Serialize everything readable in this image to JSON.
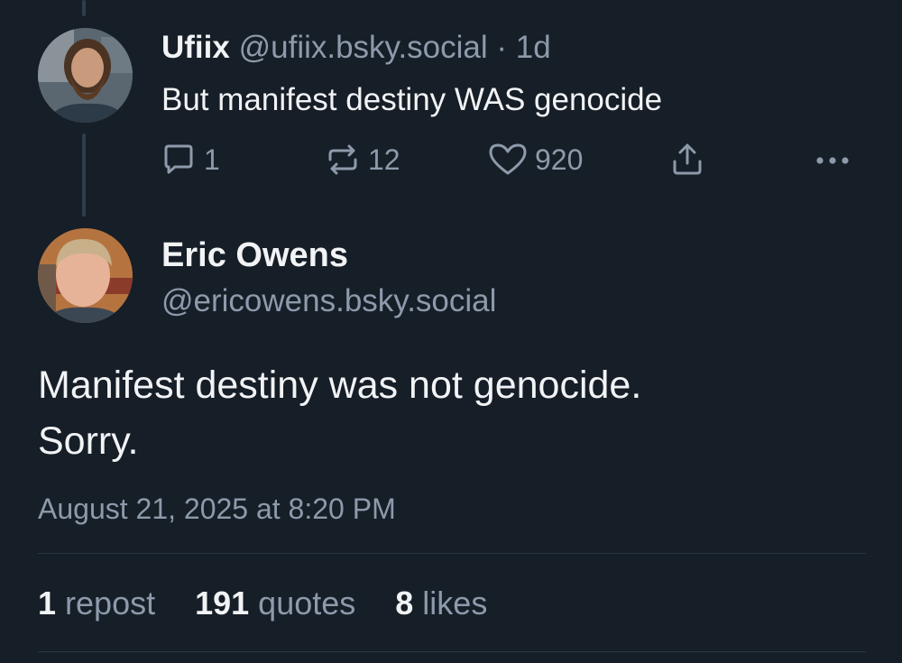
{
  "parent_post": {
    "display_name": "Ufiix",
    "handle": "@ufiix.bsky.social",
    "separator": "·",
    "age": "1d",
    "text": "But manifest destiny WAS genocide",
    "actions": {
      "reply_count": "1",
      "repost_count": "12",
      "like_count": "920"
    },
    "avatar": "avatar-bearded-man"
  },
  "main_post": {
    "display_name": "Eric Owens",
    "handle": "@ericowens.bsky.social",
    "text_lines": [
      "Manifest destiny was not genocide.",
      "Sorry."
    ],
    "timestamp": "August 21, 2025 at 8:20 PM",
    "avatar": "avatar-blond-man",
    "stats": {
      "reposts_num": "1",
      "reposts_label": "repost",
      "quotes_num": "191",
      "quotes_label": "quotes",
      "likes_num": "8",
      "likes_label": "likes"
    }
  },
  "icons": {
    "reply": "speech-bubble-icon",
    "repost": "repost-arrows-icon",
    "like": "heart-icon",
    "share": "share-upload-icon",
    "more": "more-dots-icon"
  },
  "colors": {
    "background": "#161e27",
    "primary_text": "#f1f3f5",
    "secondary_text": "#8d9aab",
    "thread_line": "#2e3e4e",
    "divider": "#2b3642"
  }
}
